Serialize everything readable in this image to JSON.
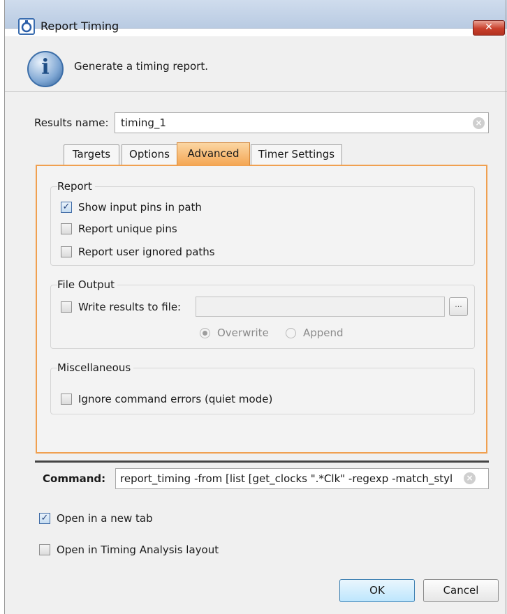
{
  "window": {
    "title": "Report Timing",
    "close_symbol": "✕"
  },
  "header": {
    "info_text": "Generate a timing report."
  },
  "results": {
    "label": "Results name:",
    "value": "timing_1"
  },
  "tabs": [
    {
      "label": "Targets"
    },
    {
      "label": "Options"
    },
    {
      "label": "Advanced",
      "active": true
    },
    {
      "label": "Timer Settings"
    }
  ],
  "report_group": {
    "title": "Report",
    "options": [
      {
        "label": "Show input pins in path",
        "checked": true
      },
      {
        "label": "Report unique pins",
        "checked": false
      },
      {
        "label": "Report user ignored paths",
        "checked": false
      }
    ]
  },
  "file_group": {
    "title": "File Output",
    "write_label": "Write results to file:",
    "write_checked": false,
    "file_value": "",
    "browse_label": "...",
    "overwrite_label": "Overwrite",
    "append_label": "Append",
    "selected_mode": "Overwrite"
  },
  "misc_group": {
    "title": "Miscellaneous",
    "ignore_label": "Ignore command errors (quiet mode)",
    "ignore_checked": false
  },
  "command": {
    "label": "Command:",
    "value": "report_timing -from [list [get_clocks \".*Clk\" -regexp -match_styl"
  },
  "bottom_options": [
    {
      "label": "Open in a new tab",
      "checked": true
    },
    {
      "label": "Open in Timing Analysis layout",
      "checked": false
    }
  ],
  "buttons": {
    "ok": "OK",
    "cancel": "Cancel"
  },
  "colors": {
    "active_tab": "#f4a653",
    "panel_border": "#f0a050",
    "close_button": "#c9402c"
  }
}
